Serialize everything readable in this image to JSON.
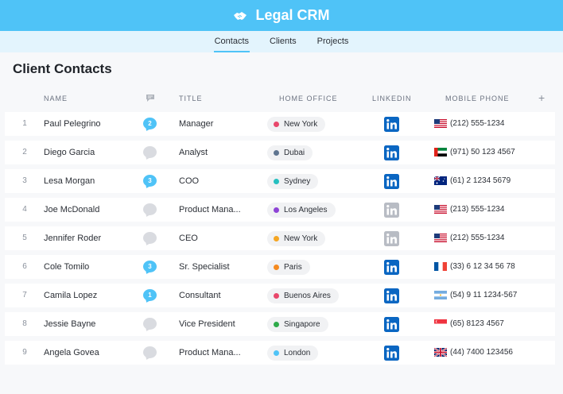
{
  "app": {
    "title": "Legal CRM"
  },
  "nav": {
    "tabs": [
      {
        "label": "Contacts",
        "active": true
      },
      {
        "label": "Clients"
      },
      {
        "label": "Projects"
      }
    ]
  },
  "page": {
    "title": "Client Contacts"
  },
  "columns": {
    "name": "NAME",
    "title": "TITLE",
    "office": "HOME OFFICE",
    "linkedin": "LINKEDIN",
    "phone": "MOBILE PHONE",
    "add": "+"
  },
  "colors": {
    "accent": "#4fc3f7",
    "linkedin_active": "#0a66c2",
    "linkedin_inactive": "#b8bcc4"
  },
  "rows": [
    {
      "num": "1",
      "name": "Paul Pelegrino",
      "comments": "2",
      "title": "Manager",
      "office": "New York",
      "office_color": "#e8476b",
      "linkedin_active": true,
      "flag": "us",
      "phone": "(212) 555-1234"
    },
    {
      "num": "2",
      "name": "Diego Garcia",
      "comments": "",
      "title": "Analyst",
      "office": "Dubai",
      "office_color": "#5f7590",
      "linkedin_active": true,
      "flag": "ae",
      "phone": "(971) 50 123 4567"
    },
    {
      "num": "3",
      "name": "Lesa Morgan",
      "comments": "3",
      "title": "COO",
      "office": "Sydney",
      "office_color": "#26c0c0",
      "linkedin_active": true,
      "flag": "au",
      "phone": "(61) 2 1234 5679"
    },
    {
      "num": "4",
      "name": "Joe McDonald",
      "comments": "",
      "title": "Product Mana...",
      "office": "Los Angeles",
      "office_color": "#8e44d6",
      "linkedin_active": false,
      "flag": "us",
      "phone": "(213) 555-1234"
    },
    {
      "num": "5",
      "name": "Jennifer Roder",
      "comments": "",
      "title": "CEO",
      "office": "New York",
      "office_color": "#f5a623",
      "linkedin_active": false,
      "flag": "us",
      "phone": "(212) 555-1234"
    },
    {
      "num": "6",
      "name": "Cole Tomilo",
      "comments": "3",
      "title": "Sr. Specialist",
      "office": "Paris",
      "office_color": "#f58a1f",
      "linkedin_active": true,
      "flag": "fr",
      "phone": "(33) 6 12 34 56 78"
    },
    {
      "num": "7",
      "name": "Camila Lopez",
      "comments": "1",
      "title": "Consultant",
      "office": "Buenos Aires",
      "office_color": "#e8476b",
      "linkedin_active": true,
      "flag": "ar",
      "phone": "(54) 9 11 1234-567"
    },
    {
      "num": "8",
      "name": "Jessie Bayne",
      "comments": "",
      "title": "Vice President",
      "office": "Singapore",
      "office_color": "#2eaa4a",
      "linkedin_active": true,
      "flag": "sg",
      "phone": "(65) 8123 4567"
    },
    {
      "num": "9",
      "name": "Angela Govea",
      "comments": "",
      "title": "Product Mana...",
      "office": "London",
      "office_color": "#4fc3f7",
      "linkedin_active": true,
      "flag": "gb",
      "phone": "(44) 7400 123456"
    }
  ]
}
